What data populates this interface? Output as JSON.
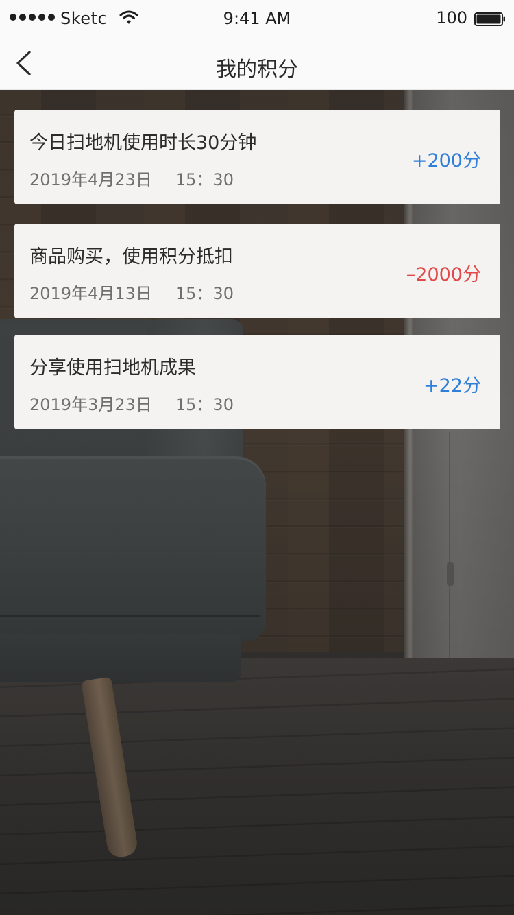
{
  "status_bar": {
    "carrier": "Sketc",
    "time": "9:41 AM",
    "battery_percent": "100",
    "battery_level": 1.0
  },
  "nav_bar": {
    "title": "我的积分",
    "back_icon": "chevron-left-icon"
  },
  "colors": {
    "positive": "#2f7fd8",
    "negative": "#e2484a"
  },
  "records": [
    {
      "title": "今日扫地机使用时长30分钟",
      "date": "2019年4月23日",
      "time": "15：30",
      "points": "+200分",
      "polarity": "positive"
    },
    {
      "title": "商品购买，使用积分抵扣",
      "date": "2019年4月13日",
      "time": "15：30",
      "points": "–2000分",
      "polarity": "negative"
    },
    {
      "title": "分享使用扫地机成果",
      "date": "2019年3月23日",
      "time": "15：30",
      "points": "+22分",
      "polarity": "positive"
    }
  ]
}
